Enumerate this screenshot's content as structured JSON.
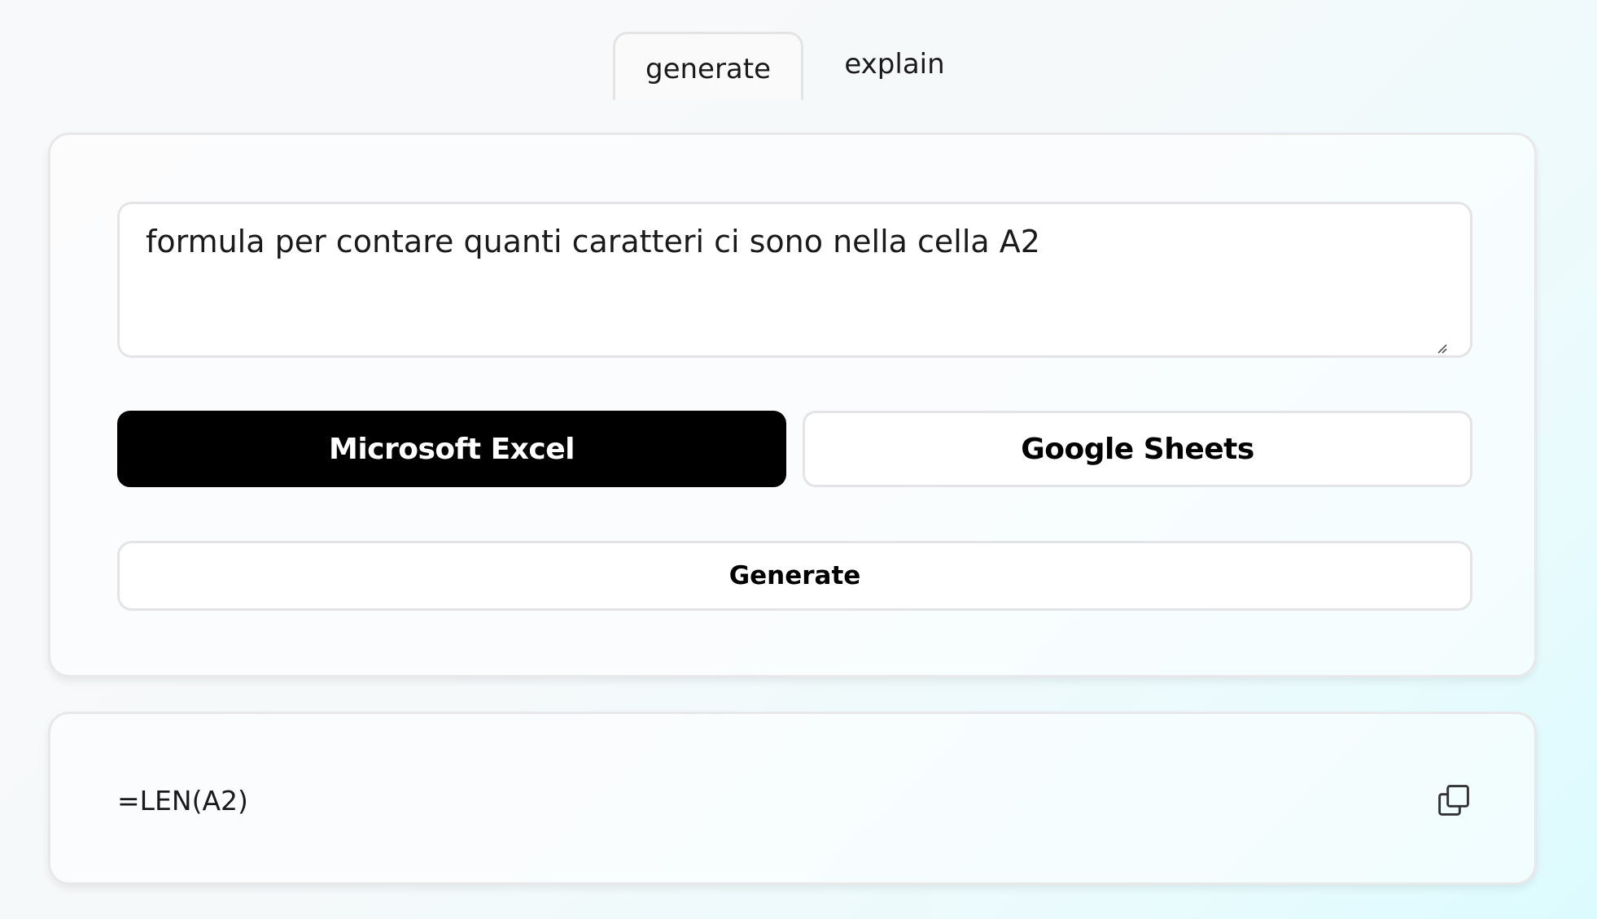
{
  "tabs": {
    "generate": "generate",
    "explain": "explain"
  },
  "input": {
    "prompt_value": "formula per contare quanti caratteri ci sono nella cella A2"
  },
  "platforms": {
    "excel_label": "Microsoft Excel",
    "sheets_label": "Google Sheets",
    "selected": "Microsoft Excel"
  },
  "actions": {
    "generate_label": "Generate"
  },
  "output": {
    "formula": "=LEN(A2)",
    "copy_icon": "copy-icon"
  },
  "colors": {
    "selected_button_bg": "#000000",
    "border": "#e4e4e7",
    "gradient_accent": "#dcfbfe"
  }
}
